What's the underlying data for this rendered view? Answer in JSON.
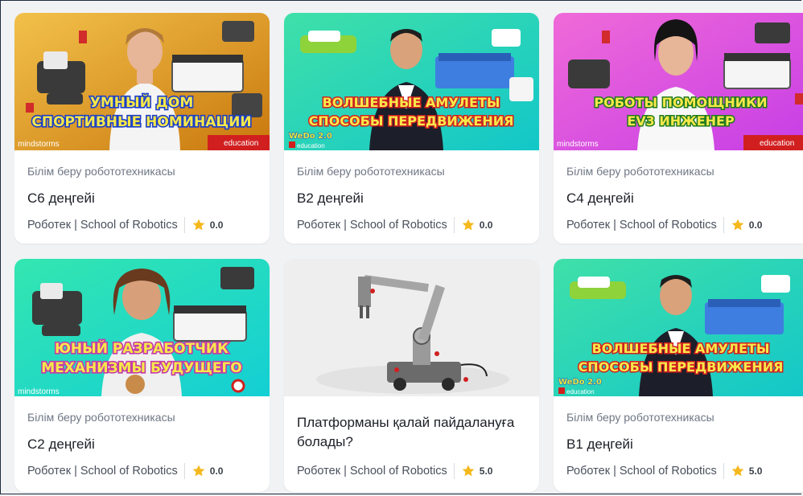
{
  "cards": [
    {
      "category": "Білім беру робототехникасы",
      "title": "С6 деңгейі",
      "author": "Роботек | School of Robotics",
      "rating": "0.0",
      "banner": [
        "УМНЫЙ ДОМ",
        "СПОРТИВНЫЕ НОМИНАЦИИ"
      ],
      "brand_left": "mindstorms",
      "brand_right": "education",
      "bg": "#e0a020"
    },
    {
      "category": "Білім беру робототехникасы",
      "title": "В2 деңгейі",
      "author": "Роботек | School of Robotics",
      "rating": "0.0",
      "banner": [
        "ВОЛШЕБНЫЕ АМУЛЕТЫ",
        "СПОСОБЫ ПЕРЕДВИЖЕНИЯ"
      ],
      "brand_left": "WeDo 2.0",
      "brand_right": "education",
      "bg": "#22d9b0"
    },
    {
      "category": "Білім беру робототехникасы",
      "title": "С4 деңгейі",
      "author": "Роботек | School of Robotics",
      "rating": "0.0",
      "banner": [
        "РОБОТЫ ПОМОЩНИКИ",
        "EV3 ИНЖЕНЕР"
      ],
      "brand_left": "mindstorms",
      "brand_right": "education",
      "bg": "#e94ee0"
    },
    {
      "category": "Білім беру робототехникасы",
      "title": "С2 деңгейі",
      "author": "Роботек | School of Robotics",
      "rating": "0.0",
      "banner": [
        "ЮНЫЙ РАЗРАБОТЧИК",
        "МЕХАНИЗМЫ БУДУЩЕГО"
      ],
      "brand_left": "mindstorms",
      "brand_right": "",
      "bg": "#1fd6c4"
    },
    {
      "category": "",
      "title": "Платформаны қалай пайдалануға болады?",
      "author": "Роботек | School of Robotics",
      "rating": "5.0",
      "banner": [],
      "brand_left": "",
      "brand_right": "",
      "bg": "#eeeeee"
    },
    {
      "category": "Білім беру робототехникасы",
      "title": "В1 деңгейі",
      "author": "Роботек | School of Robotics",
      "rating": "5.0",
      "banner": [
        "ВОЛШЕБНЫЕ АМУЛЕТЫ",
        "СПОСОБЫ ПЕРЕДВИЖЕНИЯ"
      ],
      "brand_left": "WeDo 2.0",
      "brand_right": "education",
      "bg": "#22d9b0"
    }
  ],
  "colors": {
    "banner_fill": "#f7e84a",
    "banner_fill_alt": "#d8f0ff",
    "banner_stroke": "#1a3ec9",
    "star": "#f5b81c"
  },
  "icons": {
    "rating": "star-icon"
  }
}
